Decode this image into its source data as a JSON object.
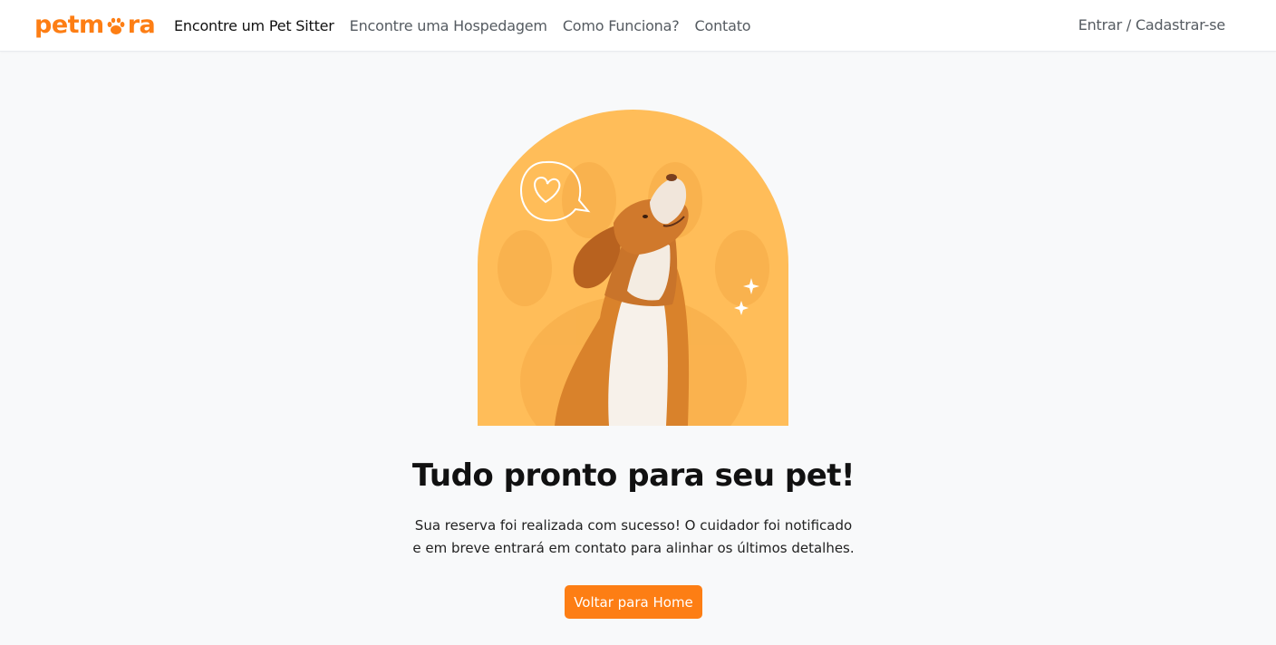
{
  "brand": {
    "logo_left": "petm",
    "logo_right": "ra",
    "primary_color": "#fd7e14"
  },
  "nav": {
    "links": [
      {
        "label": "Encontre um Pet Sitter",
        "active": true
      },
      {
        "label": "Encontre uma Hospedagem",
        "active": false
      },
      {
        "label": "Como Funciona?",
        "active": false
      },
      {
        "label": "Contato",
        "active": false
      }
    ],
    "auth_label": "Entrar / Cadastrar-se"
  },
  "hero": {
    "illustration": "dog-looking-up-with-heart-speech-bubble",
    "icons": [
      "heart-bubble-icon",
      "sparkle-icon"
    ],
    "background_color": "#ffbd59"
  },
  "confirmation": {
    "title": "Tudo pronto para seu pet!",
    "message_line1": "Sua reserva foi realizada com sucesso! O cuidador foi notificado",
    "message_line2": "e em breve entrará em contato para alinhar os últimos detalhes.",
    "button_label": "Voltar para Home"
  }
}
